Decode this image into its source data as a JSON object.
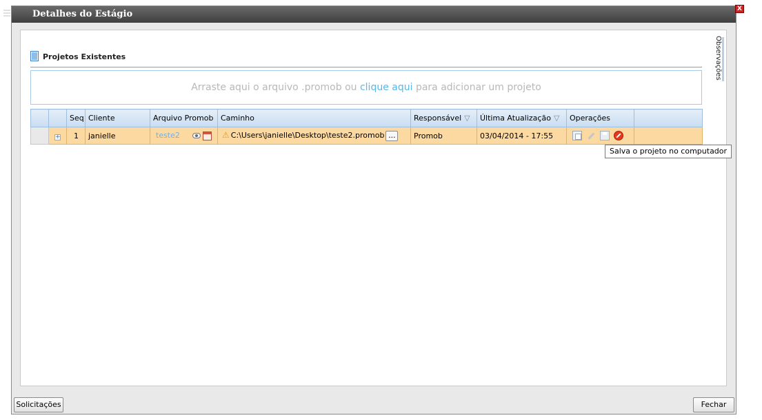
{
  "window": {
    "title": "Detalhes do Estágio",
    "close_label": "X"
  },
  "side_tab": {
    "label": "Observações"
  },
  "section": {
    "title": "Projetos Existentes"
  },
  "dropzone": {
    "before": "Arraste aqui o arquivo .promob ou ",
    "link": "clique aqui",
    "after": " para adicionar um projeto"
  },
  "grid": {
    "headers": {
      "seq": "Seq",
      "cliente": "Cliente",
      "arquivo": "Arquivo Promob",
      "caminho": "Caminho",
      "responsavel": "Responsável",
      "ultima": "Última Atualização",
      "operacoes": "Operações"
    },
    "rows": [
      {
        "expander": "+",
        "seq": "1",
        "cliente": "janielle",
        "arquivo": "teste2",
        "caminho": "C:\\Users\\janielle\\Desktop\\teste2.promob",
        "browse": "...",
        "responsavel": "Promob",
        "ultima": "03/04/2014 - 17:55"
      }
    ]
  },
  "tooltip": {
    "text": "Salva o projeto no computador"
  },
  "footer": {
    "solicitacoes": "Solicitações",
    "fechar": "Fechar"
  },
  "icons": {
    "filter": "filter-icon",
    "eye": "eye-icon",
    "calendar": "calendar-icon",
    "warning": "warning-icon",
    "copy": "copy-icon",
    "edit": "edit-icon",
    "save": "save-icon",
    "cancel": "cancel-icon"
  }
}
